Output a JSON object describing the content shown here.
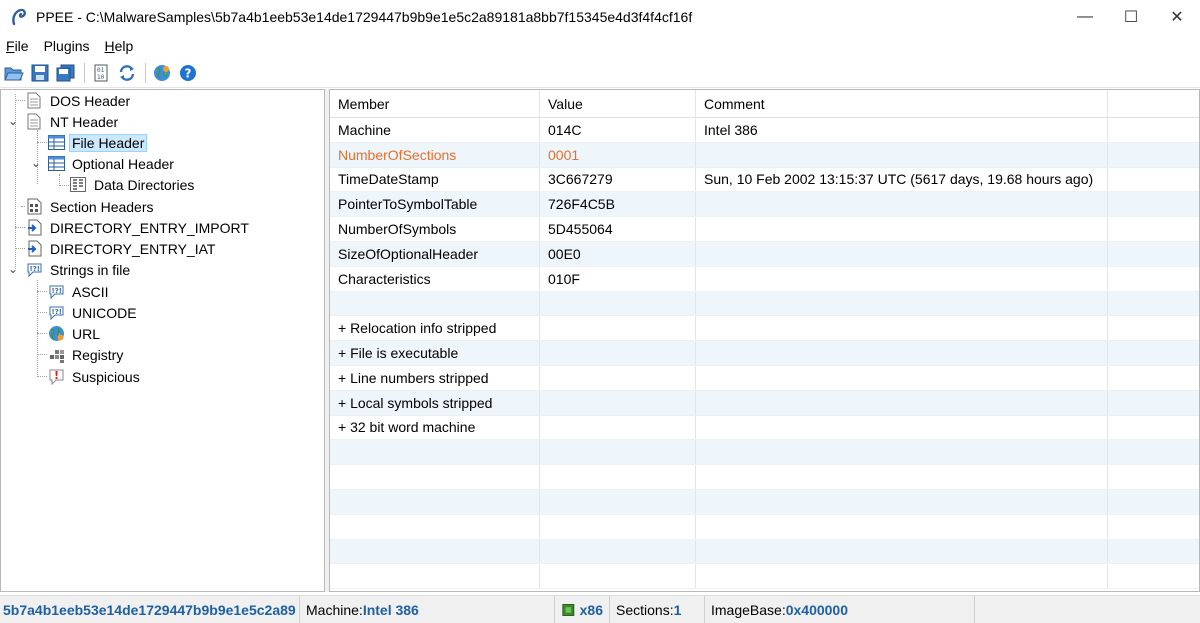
{
  "window": {
    "title": "PPEE - C:\\MalwareSamples\\5b7a4b1eeb53e14de1729447b9b9e1e5c2a89181a8bb7f15345e4d3f4f4cf16f",
    "minimize": "—",
    "maximize": "☐",
    "close": "✕"
  },
  "menu": [
    {
      "pre": "",
      "u": "F",
      "post": "ile"
    },
    {
      "pre": "",
      "u": "",
      "post": "Plugins"
    },
    {
      "pre": "",
      "u": "H",
      "post": "elp"
    }
  ],
  "tree": {
    "nodes": [
      {
        "label": "DOS Header",
        "icon": "document-icon"
      },
      {
        "label": "NT Header",
        "icon": "document-icon"
      },
      {
        "label": "File Header",
        "icon": "table-icon"
      },
      {
        "label": "Optional Header",
        "icon": "table-icon"
      },
      {
        "label": "Data Directories",
        "icon": "grid-icon"
      },
      {
        "label": "Section Headers",
        "icon": "sections-icon"
      },
      {
        "label": "DIRECTORY_ENTRY_IMPORT",
        "icon": "import-icon"
      },
      {
        "label": "DIRECTORY_ENTRY_IAT",
        "icon": "import-icon"
      },
      {
        "label": "Strings in file",
        "icon": "strings-icon"
      },
      {
        "label": "ASCII",
        "icon": "strings-icon"
      },
      {
        "label": "UNICODE",
        "icon": "strings-icon"
      },
      {
        "label": "URL",
        "icon": "globe-icon"
      },
      {
        "label": "Registry",
        "icon": "registry-icon"
      },
      {
        "label": "Suspicious",
        "icon": "warning-icon"
      }
    ]
  },
  "grid": {
    "headers": [
      "Member",
      "Value",
      "Comment"
    ],
    "rows": [
      {
        "member": "Machine",
        "value": "014C",
        "comment": "Intel 386"
      },
      {
        "member": "NumberOfSections",
        "value": "0001",
        "comment": ""
      },
      {
        "member": "TimeDateStamp",
        "value": "3C667279",
        "comment": "Sun, 10 Feb 2002 13:15:37 UTC (5617 days, 19.68 hours ago)"
      },
      {
        "member": "PointerToSymbolTable",
        "value": "726F4C5B",
        "comment": ""
      },
      {
        "member": "NumberOfSymbols",
        "value": "5D455064",
        "comment": ""
      },
      {
        "member": "SizeOfOptionalHeader",
        "value": "00E0",
        "comment": ""
      },
      {
        "member": "Characteristics",
        "value": "010F",
        "comment": ""
      },
      {
        "member": "",
        "value": "",
        "comment": ""
      },
      {
        "member": "+ Relocation info stripped",
        "value": "",
        "comment": ""
      },
      {
        "member": "+ File is executable",
        "value": "",
        "comment": ""
      },
      {
        "member": "+ Line numbers stripped",
        "value": "",
        "comment": ""
      },
      {
        "member": "+ Local symbols stripped",
        "value": "",
        "comment": ""
      },
      {
        "member": "+ 32 bit word machine",
        "value": "",
        "comment": ""
      },
      {
        "member": "",
        "value": "",
        "comment": ""
      },
      {
        "member": "",
        "value": "",
        "comment": ""
      },
      {
        "member": "",
        "value": "",
        "comment": ""
      },
      {
        "member": "",
        "value": "",
        "comment": ""
      },
      {
        "member": "",
        "value": "",
        "comment": ""
      },
      {
        "member": "",
        "value": "",
        "comment": ""
      }
    ],
    "highlight_color": "#e8702a"
  },
  "status": {
    "path": "5b7a4b1eeb53e14de1729447b9b9e1e5c2a89",
    "machine_label": "Machine: ",
    "machine_value": "Intel 386",
    "arch_value": "x86",
    "sections_label": "Sections: ",
    "sections_value": "1",
    "imagebase_label": "ImageBase: ",
    "imagebase_value": "0x400000"
  }
}
